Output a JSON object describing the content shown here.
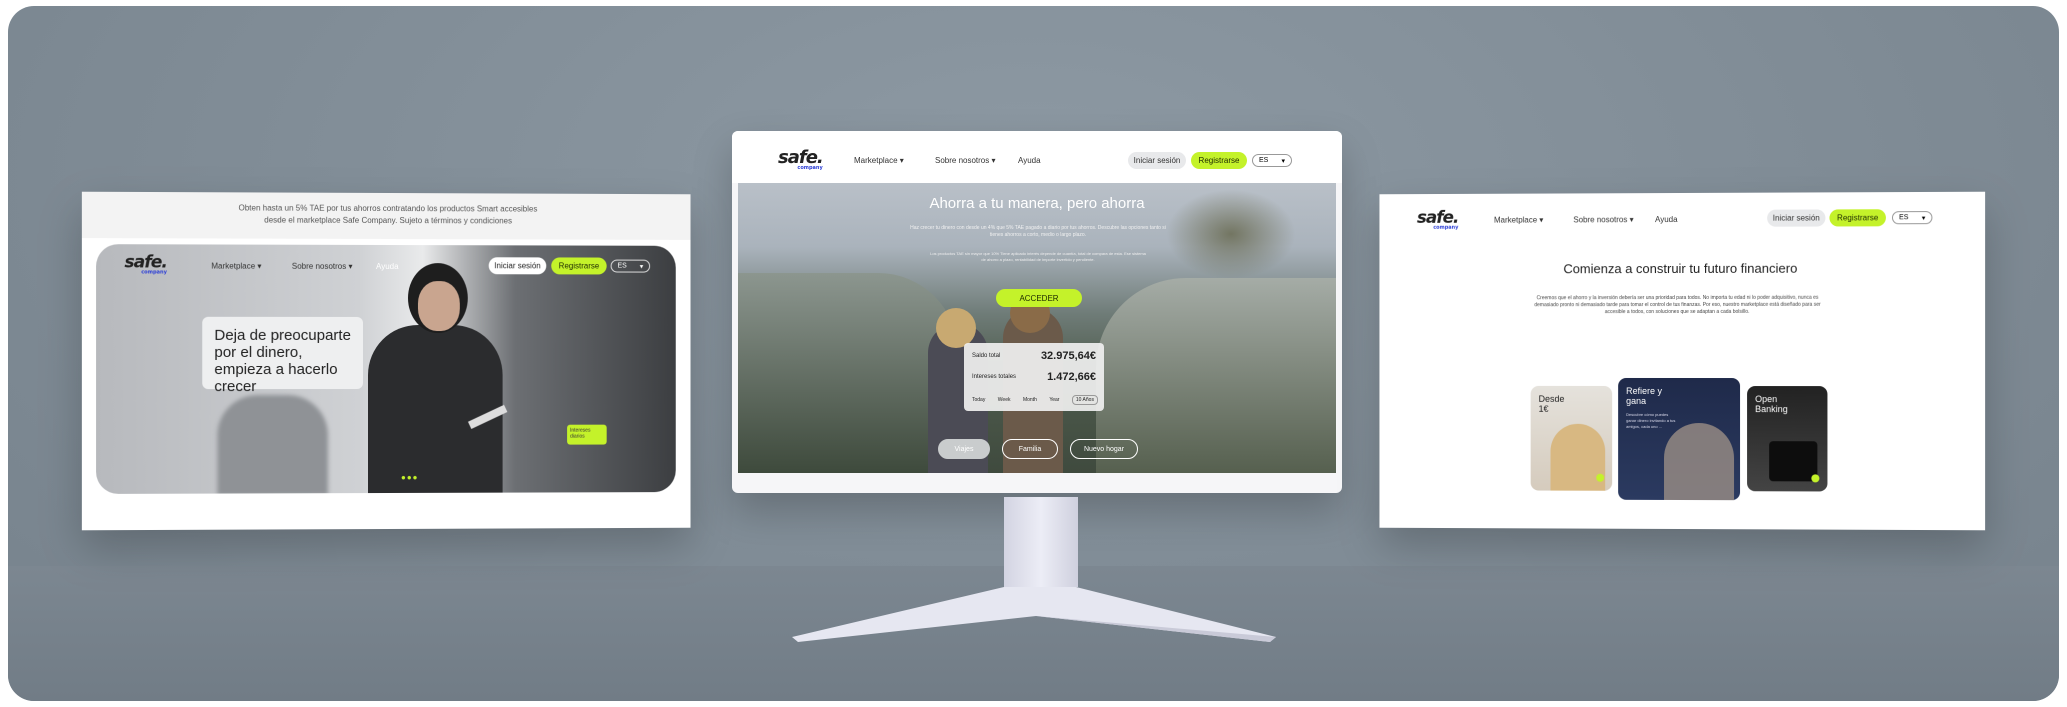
{
  "colors": {
    "accent": "#c4f22a",
    "background": "#808c96"
  },
  "left": {
    "banner": "Obten hasta un 5% TAE por tus ahorros contratando los productos Smart accesibles desde el marketplace Safe Company. Sujeto a términos y condiciones",
    "logo": "safe.",
    "logo_sub": "company",
    "nav": {
      "marketplace": "Marketplace",
      "sobre": "Sobre nosotros",
      "ayuda": "Ayuda"
    },
    "login": "Iniciar sesión",
    "register": "Registrarse",
    "lang": "ES",
    "headline": "Deja de preocuparte por el dinero, empieza a hacerlo crecer",
    "tag": "Intereses diarios"
  },
  "center": {
    "logo": "safe.",
    "logo_sub": "company",
    "nav": {
      "marketplace": "Marketplace",
      "sobre": "Sobre nosotros",
      "ayuda": "Ayuda"
    },
    "login": "Iniciar sesión",
    "register": "Registrarse",
    "lang": "ES",
    "title": "Ahorra a tu manera, pero ahorra",
    "subtitle": "Haz crecer tu dinero con desde un 4% que 5% TAE pagado a diario por tus ahorros. Descubre las opciones tanto si tienes ahorros a corto, medio o largo plazo.",
    "small": "Los productos TAE sin mayor que 10% Tiene aplicado interés depende de cuantía, total de compara de esta. Ese sistema de ahorro a plazo, rentabilidad de importe invertido y pendiente.",
    "cta": "ACCEDER",
    "calc": {
      "saldo_label": "Saldo total",
      "saldo_value": "32.975,64€",
      "intereses_label": "Intereses totales",
      "intereses_value": "1.472,66€",
      "tabs": [
        "Today",
        "Week",
        "Month",
        "Year",
        "10 Años"
      ]
    },
    "choices": [
      "Viajes",
      "Familia",
      "Nuevo hogar"
    ]
  },
  "right": {
    "logo": "safe.",
    "logo_sub": "company",
    "nav": {
      "marketplace": "Marketplace",
      "sobre": "Sobre nosotros",
      "ayuda": "Ayuda"
    },
    "login": "Iniciar sesión",
    "register": "Registrarse",
    "lang": "ES",
    "title": "Comienza a construir tu futuro financiero",
    "text": "Creemos que el ahorro y la inversión debería ser una prioridad para todos. No importa tu edad ni lo poder adquisitivo, nunca es demasiado pronto ni demasiado tarde para tomar el control de tus finanzas. Por eso, nuestro marketplace está diseñado para ser accesible a todos, con soluciones que se adaptan a cada bolsillo.",
    "cards": [
      {
        "title": "Desde 1€"
      },
      {
        "title": "Refiere y gana",
        "text": "Descubre cómo puedes ganar dinero invitando a tus amigos, cada uno ..."
      },
      {
        "title": "Open Banking"
      }
    ]
  }
}
